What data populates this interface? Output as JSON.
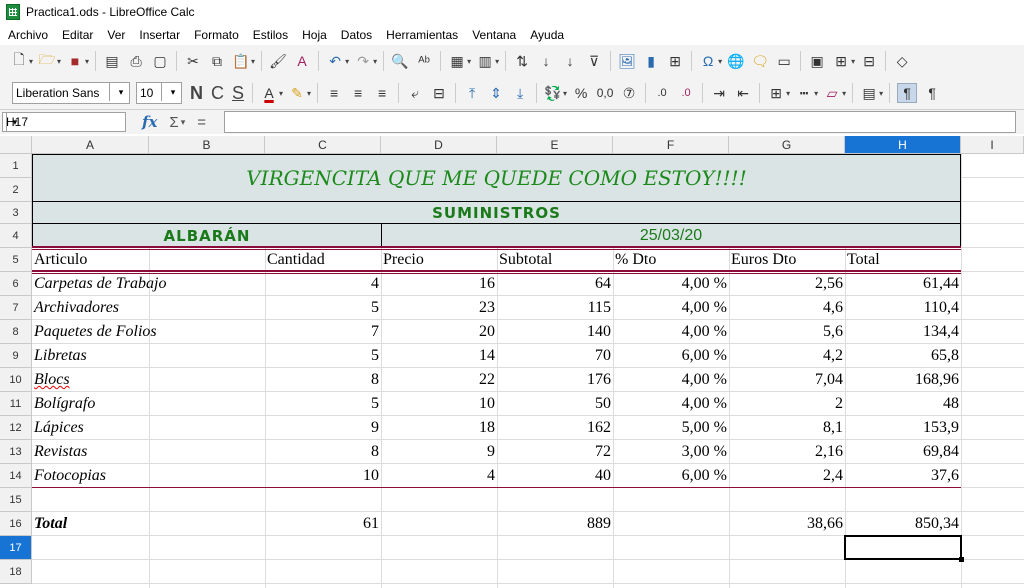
{
  "window": {
    "title": "Practica1.ods - LibreOffice Calc"
  },
  "menu": [
    "Archivo",
    "Editar",
    "Ver",
    "Insertar",
    "Formato",
    "Estilos",
    "Hoja",
    "Datos",
    "Herramientas",
    "Ventana",
    "Ayuda"
  ],
  "toolbar": {
    "font_name": "Liberation Sans",
    "font_size": "10",
    "bold": "N",
    "italic": "C",
    "underline": "S",
    "percent": "%",
    "decimal": "0,0"
  },
  "formula_bar": {
    "cell_ref": "H17",
    "fx": "fx",
    "sum": "Σ",
    "equals": "=",
    "content": ""
  },
  "columns": [
    "A",
    "B",
    "C",
    "D",
    "E",
    "F",
    "G",
    "H",
    "I"
  ],
  "rows": [
    "1",
    "2",
    "3",
    "4",
    "5",
    "6",
    "7",
    "8",
    "9",
    "10",
    "11",
    "12",
    "13",
    "14",
    "15",
    "16",
    "17",
    "18"
  ],
  "selected": {
    "column": "H",
    "row": "17"
  },
  "sheet": {
    "title": "VIRGENCITA QUE ME QUEDE COMO ESTOY!!!!",
    "subtitle": "SUMINISTROS",
    "albaran": "ALBARÁN",
    "date": "25/03/20",
    "headers": [
      "Articulo",
      "Cantidad",
      "Precio",
      "Subtotal",
      "% Dto",
      "Euros Dto",
      "Total"
    ],
    "items": [
      {
        "articulo": "Carpetas de Trabajo",
        "cantidad": "4",
        "precio": "16",
        "subtotal": "64",
        "dto": "4,00 %",
        "euros_dto": "2,56",
        "total": "61,44"
      },
      {
        "articulo": "Archivadores",
        "cantidad": "5",
        "precio": "23",
        "subtotal": "115",
        "dto": "4,00 %",
        "euros_dto": "4,6",
        "total": "110,4"
      },
      {
        "articulo": "Paquetes de Folios",
        "cantidad": "7",
        "precio": "20",
        "subtotal": "140",
        "dto": "4,00 %",
        "euros_dto": "5,6",
        "total": "134,4"
      },
      {
        "articulo": "Libretas",
        "cantidad": "5",
        "precio": "14",
        "subtotal": "70",
        "dto": "6,00 %",
        "euros_dto": "4,2",
        "total": "65,8"
      },
      {
        "articulo": "Blocs",
        "cantidad": "8",
        "precio": "22",
        "subtotal": "176",
        "dto": "4,00 %",
        "euros_dto": "7,04",
        "total": "168,96"
      },
      {
        "articulo": "Bolígrafo",
        "cantidad": "5",
        "precio": "10",
        "subtotal": "50",
        "dto": "4,00 %",
        "euros_dto": "2",
        "total": "48"
      },
      {
        "articulo": "Lápices",
        "cantidad": "9",
        "precio": "18",
        "subtotal": "162",
        "dto": "5,00 %",
        "euros_dto": "8,1",
        "total": "153,9"
      },
      {
        "articulo": "Revistas",
        "cantidad": "8",
        "precio": "9",
        "subtotal": "72",
        "dto": "3,00 %",
        "euros_dto": "2,16",
        "total": "69,84"
      },
      {
        "articulo": "Fotocopias",
        "cantidad": "10",
        "precio": "4",
        "subtotal": "40",
        "dto": "6,00 %",
        "euros_dto": "2,4",
        "total": "37,6"
      }
    ],
    "totals": {
      "label": "Total",
      "cantidad": "61",
      "subtotal": "889",
      "euros_dto": "38,66",
      "total": "850,34"
    }
  },
  "colors": {
    "accent": "#1774d4",
    "title_green": "#1b8a1b",
    "banner": "#dbe4e4",
    "maroon": "#8a0c3a"
  }
}
